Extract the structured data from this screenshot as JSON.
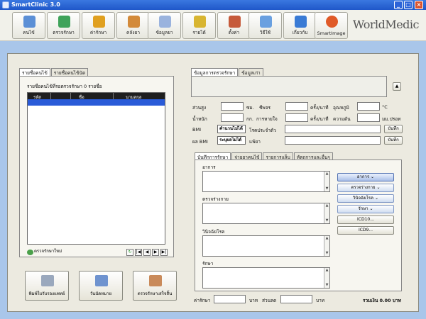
{
  "window": {
    "title": "SmartClinic 3.0"
  },
  "toolbar": {
    "buttons": [
      {
        "label": "คนไข้",
        "icon": "patient-icon"
      },
      {
        "label": "ตรวจรักษา",
        "icon": "examine-icon"
      },
      {
        "label": "ค่ารักษา",
        "icon": "billing-icon"
      },
      {
        "label": "คลังยา",
        "icon": "pharmacy-icon"
      },
      {
        "label": "ข้อมูลยา",
        "icon": "drug-info-icon"
      },
      {
        "label": "รายได้",
        "icon": "income-icon"
      },
      {
        "label": "ตั้งค่า",
        "icon": "settings-icon"
      },
      {
        "label": "วิธีใช้",
        "icon": "help-icon"
      },
      {
        "label": "เกี่ยวกับ",
        "icon": "about-icon"
      },
      {
        "label": "SmartImage",
        "icon": "smartimage-icon"
      }
    ],
    "brand": "WorldMedic"
  },
  "left": {
    "tabs": [
      "รายชื่อคนไข้",
      "รายชื่อคนไข้นัด"
    ],
    "list_title": "รายชื่อคนไข้ที่รอตรวจรักษา 0 รายชื่อ",
    "columns": [
      "รหัส",
      "",
      "ชื่อ",
      "นามสกุล"
    ],
    "new_exam_label": "ตรวจรักษาใหม่",
    "bottom_buttons": [
      "พิมพ์ใบรับรองแพทย์",
      "วันนัดหมาย",
      "ตรวจรักษาเสร็จสิ้น"
    ]
  },
  "right": {
    "top_tabs": [
      "ข้อมูลการตรวจรักษา",
      "ข้อมูลเก่า"
    ],
    "vitals": {
      "height": "ส่วนสูง",
      "cm": "ซม.",
      "pulse": "ชีพจร",
      "per_min_1": "ครั้ง/นาที",
      "temp": "อุณหภูมิ",
      "celsius": "°C",
      "weight": "น้ำหนัก",
      "kg": "กก.",
      "breath": "การหายใจ",
      "per_min_2": "ครั้ง/นาที",
      "pressure": "ความดัน",
      "mmhg": "มม.ปรอท"
    },
    "bmi_label": "BMI",
    "bmi_value": "คำนวนไม่ได้",
    "bmi_result_label": "ผล BMI",
    "bmi_result_value": "ระบุผลไม่ได้",
    "disease_label": "โรคประจำตัว",
    "allergy_label": "แพ้ยา",
    "save_label": "บันทึก",
    "sub_tabs": [
      "บันทึกการรักษา",
      "จ่ายยาคนไข้",
      "รายการแล็บ",
      "หัตถการและอื่นๆ"
    ],
    "sections": [
      "อาการ",
      "ตรวจร่างกาย",
      "วินิจฉัยโรค",
      "รักษา"
    ],
    "side_buttons": [
      "อาการ",
      "ตรวจร่างกาย",
      "วินิจฉัยโรค",
      "รักษา",
      "ICD10...",
      "ICD9..."
    ],
    "fee_label": "ค่ารักษา",
    "baht_1": "บาท",
    "discount_label": "ส่วนลด",
    "baht_2": "บาท",
    "total": "รวมเงิน 0.00 บาท"
  },
  "colors": {
    "titlebar": "#1f57c9",
    "selection": "#2a5bd8",
    "background": "#a9c6ea"
  }
}
